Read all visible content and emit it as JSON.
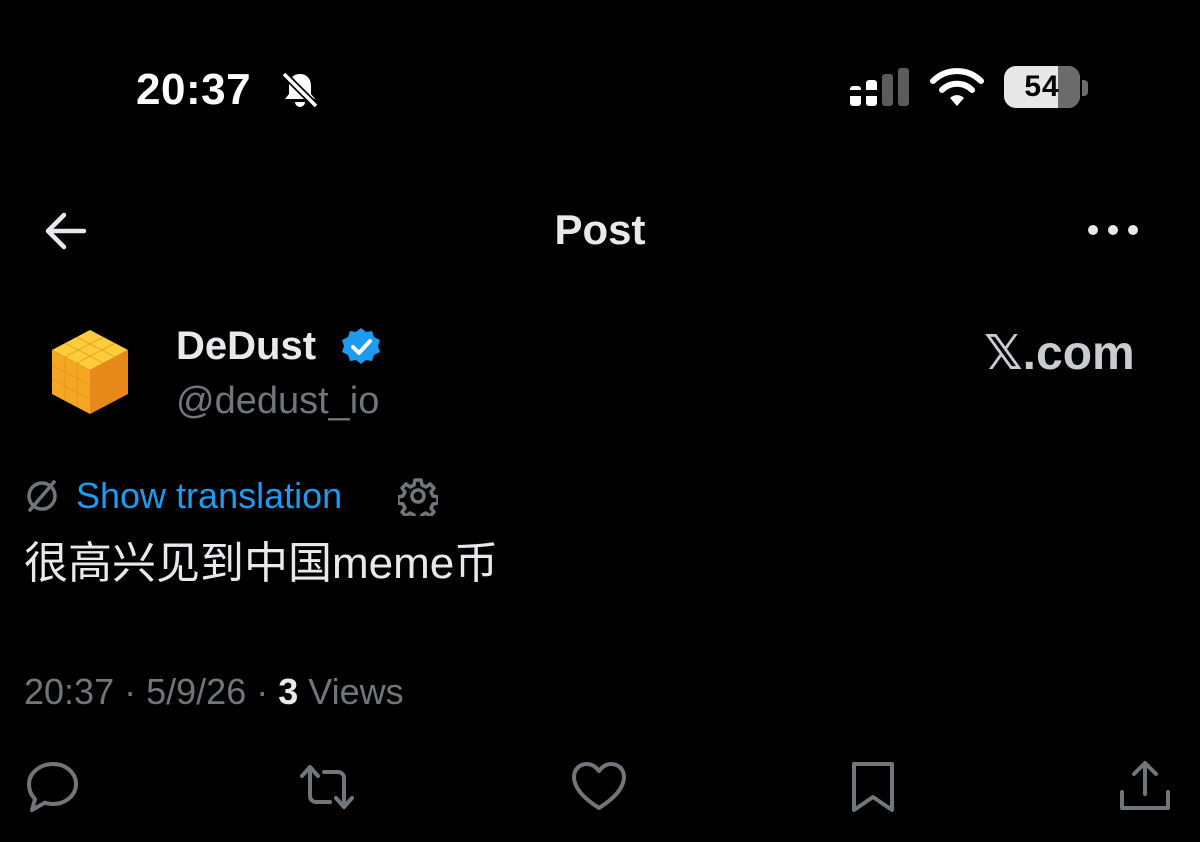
{
  "status_bar": {
    "time": "20:37",
    "battery": "54",
    "icons": [
      "bell-slash-icon",
      "signal-icon",
      "wifi-icon",
      "battery-icon"
    ]
  },
  "header": {
    "title": "Post",
    "back_icon": "arrow-left-icon",
    "more_icon": "more-horizontal-icon"
  },
  "author": {
    "name": "DeDust",
    "handle": "@dedust_io",
    "verified": true,
    "avatar_icon": "voxel-cube-avatar"
  },
  "watermark": "𝕏.com",
  "translation": {
    "label": "Show translation",
    "icon": "translate-off-icon",
    "settings_icon": "gear-icon"
  },
  "post": {
    "text": "很高兴见到中国meme币"
  },
  "meta": {
    "time": "20:37",
    "date": "5/9/26",
    "views_count": "3",
    "views_label": "Views",
    "separator": "·"
  },
  "actions": [
    "reply-icon",
    "repost-icon",
    "like-icon",
    "bookmark-icon",
    "share-icon"
  ],
  "colors": {
    "background": "#000000",
    "text": "#e7e9ea",
    "secondary": "#71767b",
    "link": "#1d9bf0",
    "verified": "#1d9bf0",
    "avatar": "#f5a623"
  }
}
